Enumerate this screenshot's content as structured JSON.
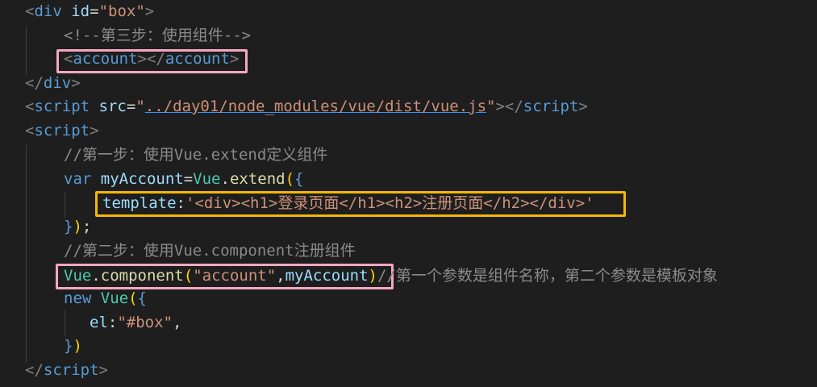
{
  "editor": {
    "theme_colors": {
      "background": "#1e1e1e",
      "tag": "#569cd6",
      "string": "#ce9178",
      "comment": "#6a9955",
      "highlight_pink": "#f4a7c0",
      "highlight_orange": "#f5b800"
    },
    "lines": {
      "l1": {
        "open": "<",
        "tag": "div",
        "attr": " id",
        "eq": "=",
        "val": "\"box\"",
        "close": ">"
      },
      "l2": {
        "comment": "<!--第三步：使用组件-->"
      },
      "l3": {
        "open": "<",
        "tag": "account",
        "mid": "></",
        "tag2": "account",
        "close": ">"
      },
      "l4": {
        "open": "</",
        "tag": "div",
        "close": ">"
      },
      "l5": {
        "open": "<",
        "tag": "script",
        "attr": " src",
        "eq": "=",
        "q1": "\"",
        "src": "../day01/node_modules/vue/dist/vue.js",
        "q2": "\"",
        "mid": "></",
        "tag2": "script",
        "close": ">"
      },
      "l6": {
        "open": "<",
        "tag": "script",
        "close": ">"
      },
      "l7": {
        "comment": "//第一步：使用Vue.extend定义组件"
      },
      "l8": {
        "kw": "var",
        "name": " myAccount",
        "eq": "=",
        "obj": "Vue",
        "dot": ".",
        "fn": "extend",
        "paren": "(",
        "brace": "{"
      },
      "l9": {
        "key": "template",
        "colon": ":",
        "value": "'<div><h1>登录页面</h1><h2>注册页面</h2></div>'"
      },
      "l10": {
        "brace": "}",
        "paren": ")",
        "semi": ";"
      },
      "l11": {
        "comment": "//第二步：使用Vue.component注册组件"
      },
      "l12": {
        "obj": "Vue",
        "dot": ".",
        "fn": "component",
        "paren": "(",
        "arg1": "\"account\"",
        "comma": ",",
        "arg2": "myAccount",
        "paren2": ")",
        "comment": "//第一个参数是组件名称，第二个参数是模板对象"
      },
      "l13": {
        "kw": "new",
        "obj": " Vue",
        "paren": "(",
        "brace": "{"
      },
      "l14": {
        "key": "el",
        "colon": ":",
        "value": "\"#box\"",
        "comma": ","
      },
      "l15": {
        "brace": "}",
        "paren": ")"
      },
      "l16": {
        "open": "</",
        "tag": "script",
        "close": ">"
      }
    }
  }
}
